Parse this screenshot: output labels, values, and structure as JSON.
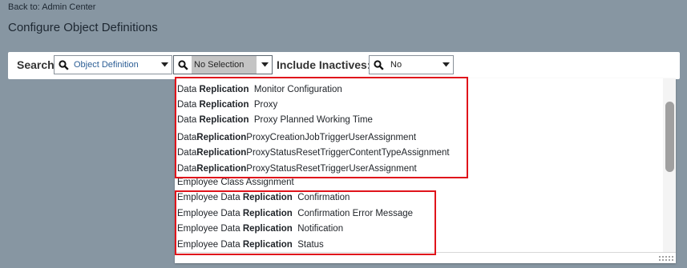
{
  "header": {
    "back_link": "Back to: Admin Center",
    "title": "Configure Object Definitions"
  },
  "toolbar": {
    "search_label": "Search",
    "object_type_value": "Object Definition",
    "object_value": "No Selection",
    "include_inactives_label": "Include Inactives:",
    "include_inactives_value": "No"
  },
  "dropdown": {
    "items": [
      {
        "pre": "Data ",
        "bold": "Replication",
        "post": "  Monitor Configuration"
      },
      {
        "pre": "Data ",
        "bold": "Replication",
        "post": "  Proxy"
      },
      {
        "pre": "Data ",
        "bold": "Replication",
        "post": "  Proxy Planned Working Time"
      },
      {
        "pre": "Data",
        "bold": "Replication",
        "post": "ProxyCreationJobTriggerUserAssignment"
      },
      {
        "pre": "Data",
        "bold": "Replication",
        "post": "ProxyStatusResetTriggerContentTypeAssignment"
      },
      {
        "pre": "Data",
        "bold": "Replication",
        "post": "ProxyStatusResetTriggerUserAssignment"
      },
      {
        "pre": "Employee Class Assignment",
        "bold": "",
        "post": ""
      },
      {
        "pre": "Employee Data ",
        "bold": "Replication",
        "post": "  Confirmation"
      },
      {
        "pre": "Employee Data ",
        "bold": "Replication",
        "post": "  Confirmation Error Message"
      },
      {
        "pre": "Employee Data ",
        "bold": "Replication",
        "post": "  Notification"
      },
      {
        "pre": "Employee Data ",
        "bold": "Replication",
        "post": "  Status"
      }
    ]
  },
  "colors": {
    "background": "#8796a2",
    "highlight": "#e0141b",
    "link": "#2c5e95"
  },
  "icons": {
    "search": "magnifier-icon",
    "dropdown": "caret-down-icon"
  }
}
